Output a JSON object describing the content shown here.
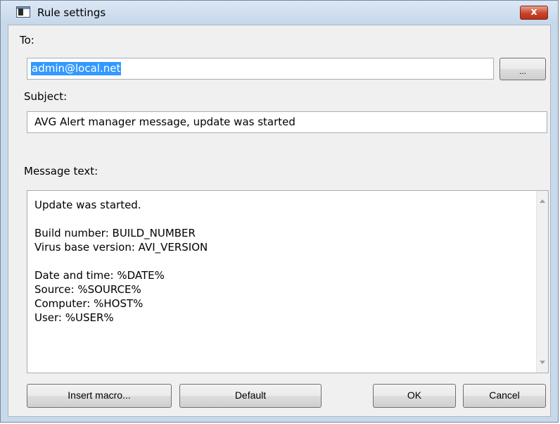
{
  "window": {
    "title": "Rule settings",
    "close_label": "x"
  },
  "to": {
    "label": "To:",
    "value": "admin@local.net",
    "browse_label": "..."
  },
  "subject": {
    "label": "Subject:",
    "value": "AVG Alert manager message, update was started"
  },
  "message": {
    "label": "Message text:",
    "lines": [
      "Update was started.",
      "",
      "Build number: BUILD_NUMBER",
      "Virus base version: AVI_VERSION",
      "",
      "Date and time: %DATE%",
      "Source: %SOURCE%",
      "Computer: %HOST%",
      "User: %USER%"
    ]
  },
  "buttons": {
    "insert_macro": "Insert macro...",
    "default": "Default",
    "ok": "OK",
    "cancel": "Cancel"
  }
}
